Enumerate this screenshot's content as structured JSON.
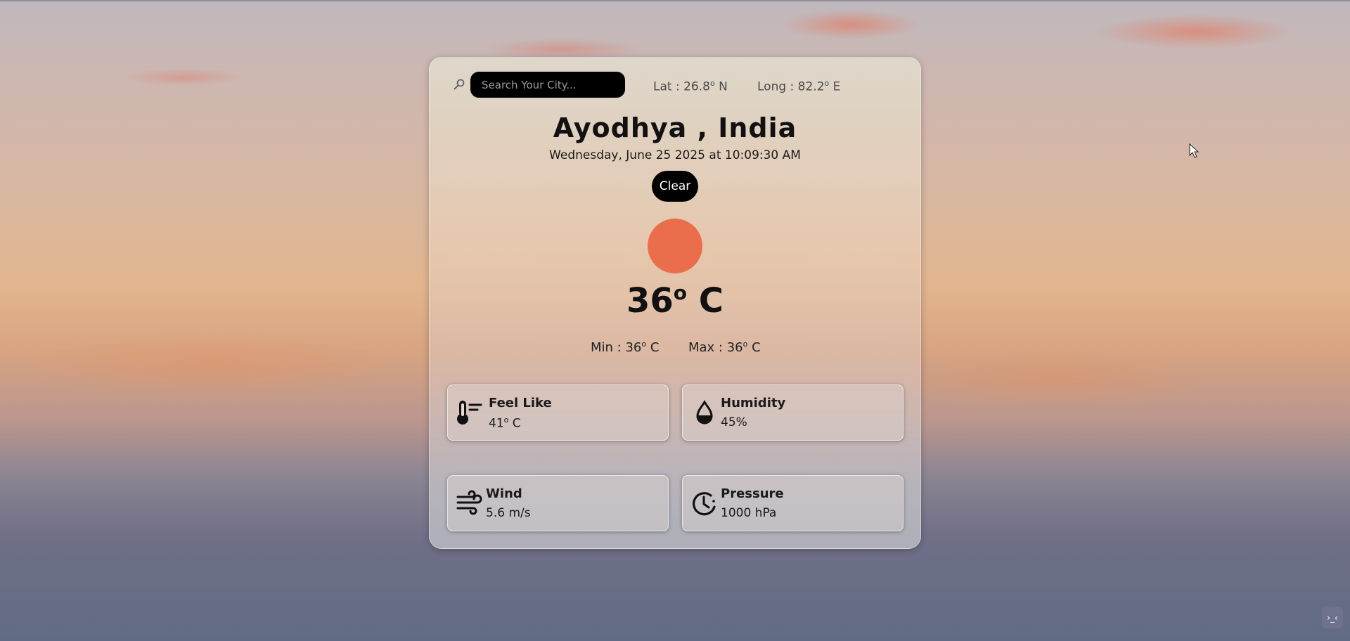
{
  "search": {
    "placeholder": "Search Your City..."
  },
  "coords": {
    "lat_prefix": "Lat : 26.8",
    "lat_unit": "o",
    "lat_suffix": " N",
    "long_prefix": "Long : 82.2",
    "long_unit": "o",
    "long_suffix": " E"
  },
  "location": "Ayodhya , India",
  "datetime": "Wednesday, June 25 2025 at 10:09:30 AM",
  "condition": "Clear",
  "temperature": {
    "value": "36",
    "deg": "o",
    "unit": " C"
  },
  "minmax": {
    "min_prefix": "Min : 36",
    "min_deg": "o",
    "min_unit": " C",
    "max_prefix": "Max : 36",
    "max_deg": "o",
    "max_unit": " C"
  },
  "tiles": [
    {
      "label": "Feel Like",
      "value": "41",
      "deg": "o",
      "unit": " C",
      "icon": "thermometer-icon"
    },
    {
      "label": "Humidity",
      "value": "45%",
      "icon": "droplet-icon"
    },
    {
      "label": "Wind",
      "value": "5.6 m/s",
      "icon": "wind-icon"
    },
    {
      "label": "Pressure",
      "value": "1000 hPa",
      "icon": "gauge-icon"
    }
  ],
  "corner_button": "›_‹",
  "colors": {
    "sun": "#ea6e4c",
    "badge_bg": "#000000",
    "search_bg": "#000000"
  }
}
